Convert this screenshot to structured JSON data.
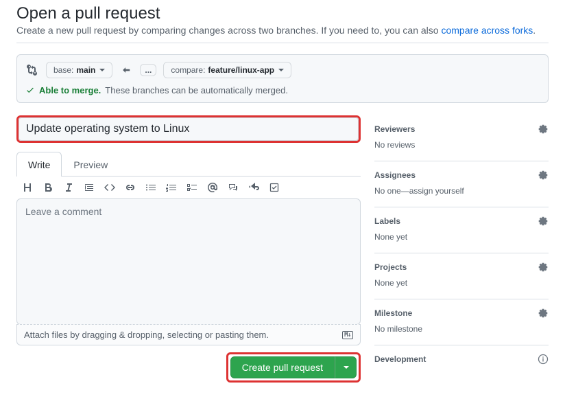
{
  "page": {
    "title": "Open a pull request",
    "subtitle_prefix": "Create a new pull request by comparing changes across two branches. If you need to, you can also ",
    "subtitle_link": "compare across forks",
    "subtitle_suffix": "."
  },
  "range": {
    "base_label": "base:",
    "base_value": "main",
    "compare_label": "compare:",
    "compare_value": "feature/linux-app",
    "dots": "...",
    "merge_able": "Able to merge.",
    "merge_rest": "These branches can be automatically merged."
  },
  "form": {
    "title_value": "Update operating system to Linux",
    "tab_write": "Write",
    "tab_preview": "Preview",
    "comment_placeholder": "Leave a comment",
    "attach_hint": "Attach files by dragging & dropping, selecting or pasting them.",
    "md_badge": "M↓",
    "create_label": "Create pull request"
  },
  "sidebar": {
    "reviewers": {
      "title": "Reviewers",
      "body": "No reviews"
    },
    "assignees": {
      "title": "Assignees",
      "body_prefix": "No one—",
      "assign_self": "assign yourself"
    },
    "labels": {
      "title": "Labels",
      "body": "None yet"
    },
    "projects": {
      "title": "Projects",
      "body": "None yet"
    },
    "milestone": {
      "title": "Milestone",
      "body": "No milestone"
    },
    "development": {
      "title": "Development"
    }
  }
}
